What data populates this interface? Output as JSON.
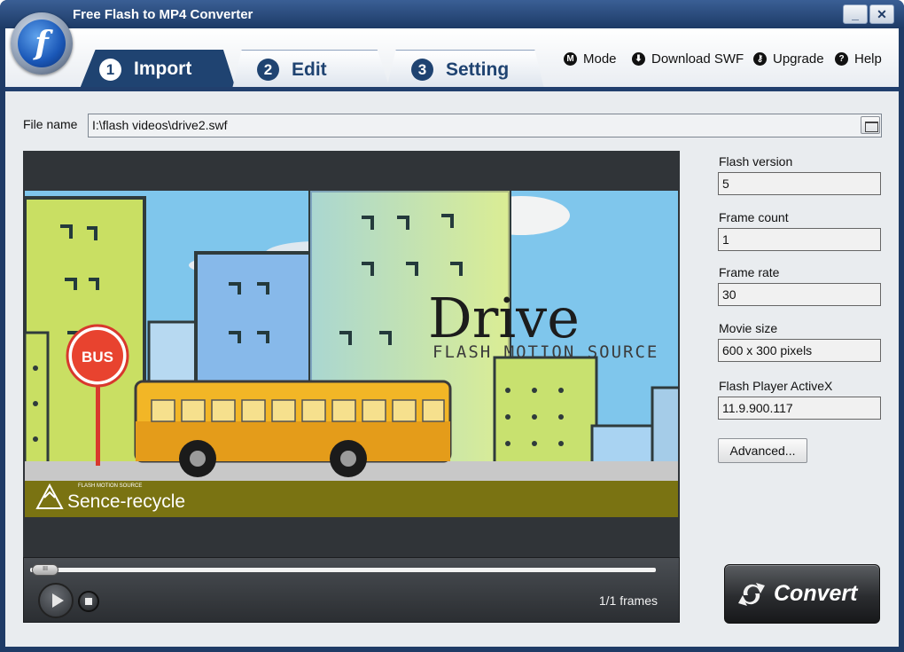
{
  "window": {
    "title": "Free Flash to MP4 Converter",
    "minimize": "_",
    "close": "✕"
  },
  "tabs": [
    {
      "num": "1",
      "label": "Import"
    },
    {
      "num": "2",
      "label": "Edit"
    },
    {
      "num": "3",
      "label": "Setting"
    }
  ],
  "menu": {
    "mode": {
      "icon": "M",
      "label": "Mode"
    },
    "download": {
      "icon": "⬇",
      "label": "Download SWF"
    },
    "upgrade": {
      "icon": "🔑",
      "label": "Upgrade"
    },
    "help": {
      "icon": "?",
      "label": "Help"
    }
  },
  "file": {
    "label": "File name",
    "value": "I:\\flash videos\\drive2.swf"
  },
  "video": {
    "title": "Drive",
    "subtitle": "FLASH MOTION SOURCE",
    "bus_sign": "BUS",
    "watermark_small": "FLASH MOTION SOURCE",
    "watermark": "Sence-recycle"
  },
  "info": {
    "flash_version_label": "Flash version",
    "flash_version": "5",
    "frame_count_label": "Frame count",
    "frame_count": "1",
    "frame_rate_label": "Frame rate",
    "frame_rate": "30",
    "movie_size_label": "Movie size",
    "movie_size": "600 x 300 pixels",
    "player_label": "Flash Player ActiveX",
    "player": "11.9.900.117"
  },
  "buttons": {
    "advanced": "Advanced...",
    "convert": "Convert"
  },
  "player": {
    "frames": "1/1 frames",
    "seek_position": 0.0,
    "knob_text": "III"
  }
}
